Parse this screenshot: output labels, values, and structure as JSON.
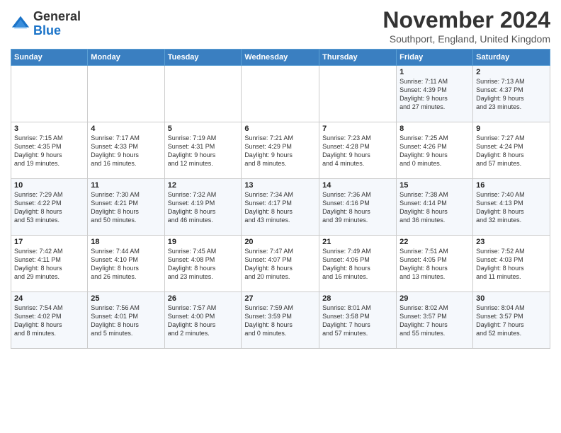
{
  "header": {
    "logo_general": "General",
    "logo_blue": "Blue",
    "month_title": "November 2024",
    "subtitle": "Southport, England, United Kingdom"
  },
  "days_of_week": [
    "Sunday",
    "Monday",
    "Tuesday",
    "Wednesday",
    "Thursday",
    "Friday",
    "Saturday"
  ],
  "weeks": [
    [
      {
        "day": "",
        "info": ""
      },
      {
        "day": "",
        "info": ""
      },
      {
        "day": "",
        "info": ""
      },
      {
        "day": "",
        "info": ""
      },
      {
        "day": "",
        "info": ""
      },
      {
        "day": "1",
        "info": "Sunrise: 7:11 AM\nSunset: 4:39 PM\nDaylight: 9 hours\nand 27 minutes."
      },
      {
        "day": "2",
        "info": "Sunrise: 7:13 AM\nSunset: 4:37 PM\nDaylight: 9 hours\nand 23 minutes."
      }
    ],
    [
      {
        "day": "3",
        "info": "Sunrise: 7:15 AM\nSunset: 4:35 PM\nDaylight: 9 hours\nand 19 minutes."
      },
      {
        "day": "4",
        "info": "Sunrise: 7:17 AM\nSunset: 4:33 PM\nDaylight: 9 hours\nand 16 minutes."
      },
      {
        "day": "5",
        "info": "Sunrise: 7:19 AM\nSunset: 4:31 PM\nDaylight: 9 hours\nand 12 minutes."
      },
      {
        "day": "6",
        "info": "Sunrise: 7:21 AM\nSunset: 4:29 PM\nDaylight: 9 hours\nand 8 minutes."
      },
      {
        "day": "7",
        "info": "Sunrise: 7:23 AM\nSunset: 4:28 PM\nDaylight: 9 hours\nand 4 minutes."
      },
      {
        "day": "8",
        "info": "Sunrise: 7:25 AM\nSunset: 4:26 PM\nDaylight: 9 hours\nand 0 minutes."
      },
      {
        "day": "9",
        "info": "Sunrise: 7:27 AM\nSunset: 4:24 PM\nDaylight: 8 hours\nand 57 minutes."
      }
    ],
    [
      {
        "day": "10",
        "info": "Sunrise: 7:29 AM\nSunset: 4:22 PM\nDaylight: 8 hours\nand 53 minutes."
      },
      {
        "day": "11",
        "info": "Sunrise: 7:30 AM\nSunset: 4:21 PM\nDaylight: 8 hours\nand 50 minutes."
      },
      {
        "day": "12",
        "info": "Sunrise: 7:32 AM\nSunset: 4:19 PM\nDaylight: 8 hours\nand 46 minutes."
      },
      {
        "day": "13",
        "info": "Sunrise: 7:34 AM\nSunset: 4:17 PM\nDaylight: 8 hours\nand 43 minutes."
      },
      {
        "day": "14",
        "info": "Sunrise: 7:36 AM\nSunset: 4:16 PM\nDaylight: 8 hours\nand 39 minutes."
      },
      {
        "day": "15",
        "info": "Sunrise: 7:38 AM\nSunset: 4:14 PM\nDaylight: 8 hours\nand 36 minutes."
      },
      {
        "day": "16",
        "info": "Sunrise: 7:40 AM\nSunset: 4:13 PM\nDaylight: 8 hours\nand 32 minutes."
      }
    ],
    [
      {
        "day": "17",
        "info": "Sunrise: 7:42 AM\nSunset: 4:11 PM\nDaylight: 8 hours\nand 29 minutes."
      },
      {
        "day": "18",
        "info": "Sunrise: 7:44 AM\nSunset: 4:10 PM\nDaylight: 8 hours\nand 26 minutes."
      },
      {
        "day": "19",
        "info": "Sunrise: 7:45 AM\nSunset: 4:08 PM\nDaylight: 8 hours\nand 23 minutes."
      },
      {
        "day": "20",
        "info": "Sunrise: 7:47 AM\nSunset: 4:07 PM\nDaylight: 8 hours\nand 20 minutes."
      },
      {
        "day": "21",
        "info": "Sunrise: 7:49 AM\nSunset: 4:06 PM\nDaylight: 8 hours\nand 16 minutes."
      },
      {
        "day": "22",
        "info": "Sunrise: 7:51 AM\nSunset: 4:05 PM\nDaylight: 8 hours\nand 13 minutes."
      },
      {
        "day": "23",
        "info": "Sunrise: 7:52 AM\nSunset: 4:03 PM\nDaylight: 8 hours\nand 11 minutes."
      }
    ],
    [
      {
        "day": "24",
        "info": "Sunrise: 7:54 AM\nSunset: 4:02 PM\nDaylight: 8 hours\nand 8 minutes."
      },
      {
        "day": "25",
        "info": "Sunrise: 7:56 AM\nSunset: 4:01 PM\nDaylight: 8 hours\nand 5 minutes."
      },
      {
        "day": "26",
        "info": "Sunrise: 7:57 AM\nSunset: 4:00 PM\nDaylight: 8 hours\nand 2 minutes."
      },
      {
        "day": "27",
        "info": "Sunrise: 7:59 AM\nSunset: 3:59 PM\nDaylight: 8 hours\nand 0 minutes."
      },
      {
        "day": "28",
        "info": "Sunrise: 8:01 AM\nSunset: 3:58 PM\nDaylight: 7 hours\nand 57 minutes."
      },
      {
        "day": "29",
        "info": "Sunrise: 8:02 AM\nSunset: 3:57 PM\nDaylight: 7 hours\nand 55 minutes."
      },
      {
        "day": "30",
        "info": "Sunrise: 8:04 AM\nSunset: 3:57 PM\nDaylight: 7 hours\nand 52 minutes."
      }
    ]
  ]
}
